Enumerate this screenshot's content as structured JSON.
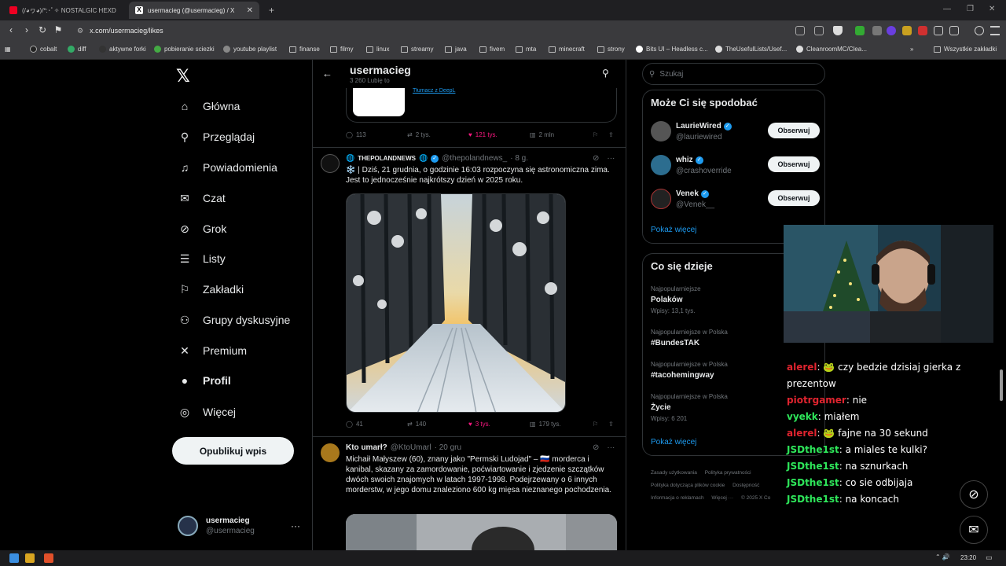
{
  "browser": {
    "tabs": [
      {
        "label": "(/◕ヮ◕)/*:･ﾟ✧ NOSTALGIC HEXD"
      },
      {
        "label": "usermacieg (@usermacieg) / X"
      }
    ],
    "new_tab": "+",
    "url": "x.com/usermacieg/likes",
    "bookmarks": [
      "cobalt",
      "diff",
      "aktywne forki",
      "pobieranie sciezki",
      "youtube playlist",
      "finanse",
      "filmy",
      "linux",
      "streamy",
      "java",
      "fivem",
      "mta",
      "minecraft",
      "strony",
      "Bits UI – Headless c...",
      "TheUsefulLists/Usef...",
      "CleanroomMC/Clea..."
    ],
    "bookmarks_more": "»",
    "all_bookmarks": "Wszystkie zakładki"
  },
  "nav": {
    "items": [
      "Główna",
      "Przeglądaj",
      "Powiadomienia",
      "Czat",
      "Grok",
      "Listy",
      "Zakładki",
      "Grupy dyskusyjne",
      "Premium",
      "Profil",
      "Więcej"
    ],
    "post_button": "Opublikuj wpis",
    "account_name": "usermacieg",
    "account_handle": "@usermacieg"
  },
  "header": {
    "title": "usermacieg",
    "subtitle": "3 260 Lubię to"
  },
  "top_card": {
    "translate": "Tłumacz z DeepL"
  },
  "post0_actions": {
    "replies": "113",
    "reposts": "2 tys.",
    "likes": "121 tys.",
    "views": "2 mln"
  },
  "post1": {
    "name": "THEPOLANDNEWS",
    "handle": "@thepolandnews_",
    "time": "· 8 g.",
    "text": "❄️ | Dziś, 21 grudnia, o godzinie 16:03 rozpoczyna się astronomiczna zima. Jest to jednocześnie najkrótszy dzień w 2025 roku.",
    "replies": "41",
    "reposts": "140",
    "likes": "3 tys.",
    "views": "179 tys."
  },
  "post2": {
    "name": "Kto umarł?",
    "handle": "@KtoUmarl",
    "time": "· 20 gru",
    "text": "Michaił Małyszew (60), znany jako \"Permski Ludojad\" – 🇷🇺 morderca i kanibal, skazany za zamordowanie, poćwiartowanie i zjedzenie szczątków dwóch swoich znajomych w latach 1997-1998. Podejrzewany o 6 innych morderstw, w jego domu znaleziono 600 kg mięsa nieznanego pochodzenia."
  },
  "search": {
    "placeholder": "Szukaj"
  },
  "who_to_follow": {
    "title": "Może Ci się spodobać",
    "users": [
      {
        "name": "LaurieWired",
        "handle": "@lauriewired",
        "button": "Obserwuj"
      },
      {
        "name": "whiz",
        "handle": "@crashoverride",
        "button": "Obserwuj"
      },
      {
        "name": "Venek",
        "handle": "@Venek__",
        "button": "Obserwuj"
      }
    ],
    "more": "Pokaż więcej"
  },
  "trends": {
    "title": "Co się dzieje",
    "items": [
      {
        "context": "Najpopularniejsze",
        "topic": "Polaków",
        "count": "Wpisy: 13,1 tys."
      },
      {
        "context": "Najpopularniejsze w Polska",
        "topic": "#BundesTAK",
        "count": ""
      },
      {
        "context": "Najpopularniejsze w Polska",
        "topic": "#tacohemingway",
        "count": ""
      },
      {
        "context": "Najpopularniejsze w Polska",
        "topic": "Życie",
        "count": "Wpisy: 6 201"
      }
    ],
    "more": "Pokaż więcej"
  },
  "footer": {
    "links": [
      "Zasady użytkowania",
      "Polityka prywatności",
      "Polityka dotycząca plików cookie",
      "Dostępność",
      "Informacja o reklamach",
      "Więcej ···",
      "© 2025 X Co"
    ]
  },
  "chat": {
    "messages": [
      {
        "user": "alerel",
        "text": "czy bedzie dzisiaj gierka z prezentow",
        "color": "#e0242f"
      },
      {
        "user": "piotrgamer",
        "text": "nie",
        "color": "#e0242f"
      },
      {
        "user": "vyekk",
        "text": "miałem",
        "color": "#2ee65a"
      },
      {
        "user": "alerel",
        "text": "fajne na 30 sekund",
        "color": "#e0242f"
      },
      {
        "user": "JSDthe1st",
        "text": "a miales te kulki?",
        "color": "#2ee65a"
      },
      {
        "user": "JSDthe1st",
        "text": "na sznurkach",
        "color": "#2ee65a"
      },
      {
        "user": "JSDthe1st",
        "text": "co sie odbijaja",
        "color": "#2ee65a"
      },
      {
        "user": "JSDthe1st",
        "text": "na koncach",
        "color": "#2ee65a"
      }
    ]
  },
  "taskbar": {
    "time": "23:20"
  },
  "colors": {
    "accent": "#1d9bf0",
    "like": "#f91880",
    "bg": "#000000",
    "border": "#2f3336"
  }
}
